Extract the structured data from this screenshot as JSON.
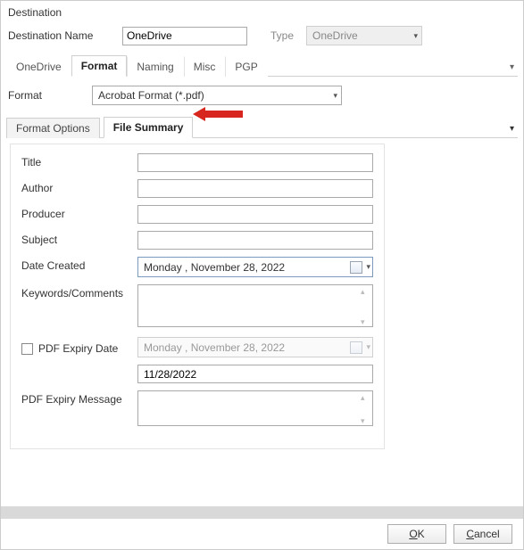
{
  "window": {
    "title": "Destination"
  },
  "header": {
    "destName_label": "Destination Name",
    "destName_value": "OneDrive",
    "type_label": "Type",
    "type_value": "OneDrive"
  },
  "tabs": {
    "items": [
      {
        "label": "OneDrive"
      },
      {
        "label": "Format"
      },
      {
        "label": "Naming"
      },
      {
        "label": "Misc"
      },
      {
        "label": "PGP"
      }
    ],
    "active_index": 1
  },
  "format": {
    "label": "Format",
    "value": "Acrobat Format (*.pdf)"
  },
  "subtabs": {
    "items": [
      {
        "label": "Format Options"
      },
      {
        "label": "File Summary"
      }
    ],
    "active_index": 1
  },
  "form": {
    "title_label": "Title",
    "title_value": "",
    "author_label": "Author",
    "author_value": "",
    "producer_label": "Producer",
    "producer_value": "",
    "subject_label": "Subject",
    "subject_value": "",
    "datecreated_label": "Date Created",
    "datecreated_value": "Monday   , November  28, 2022",
    "keywords_label": "Keywords/Comments",
    "keywords_value": "",
    "expiry_label": "PDF Expiry Date",
    "expiry_value": "Monday   , November  28, 2022",
    "expiry_short_value": "11/28/2022",
    "expiry_msg_label": "PDF Expiry Message",
    "expiry_msg_value": ""
  },
  "footer": {
    "ok_full": "OK",
    "ok_u": "O",
    "ok_rest": "K",
    "cancel_full": "Cancel",
    "cancel_u": "C",
    "cancel_rest": "ancel"
  }
}
